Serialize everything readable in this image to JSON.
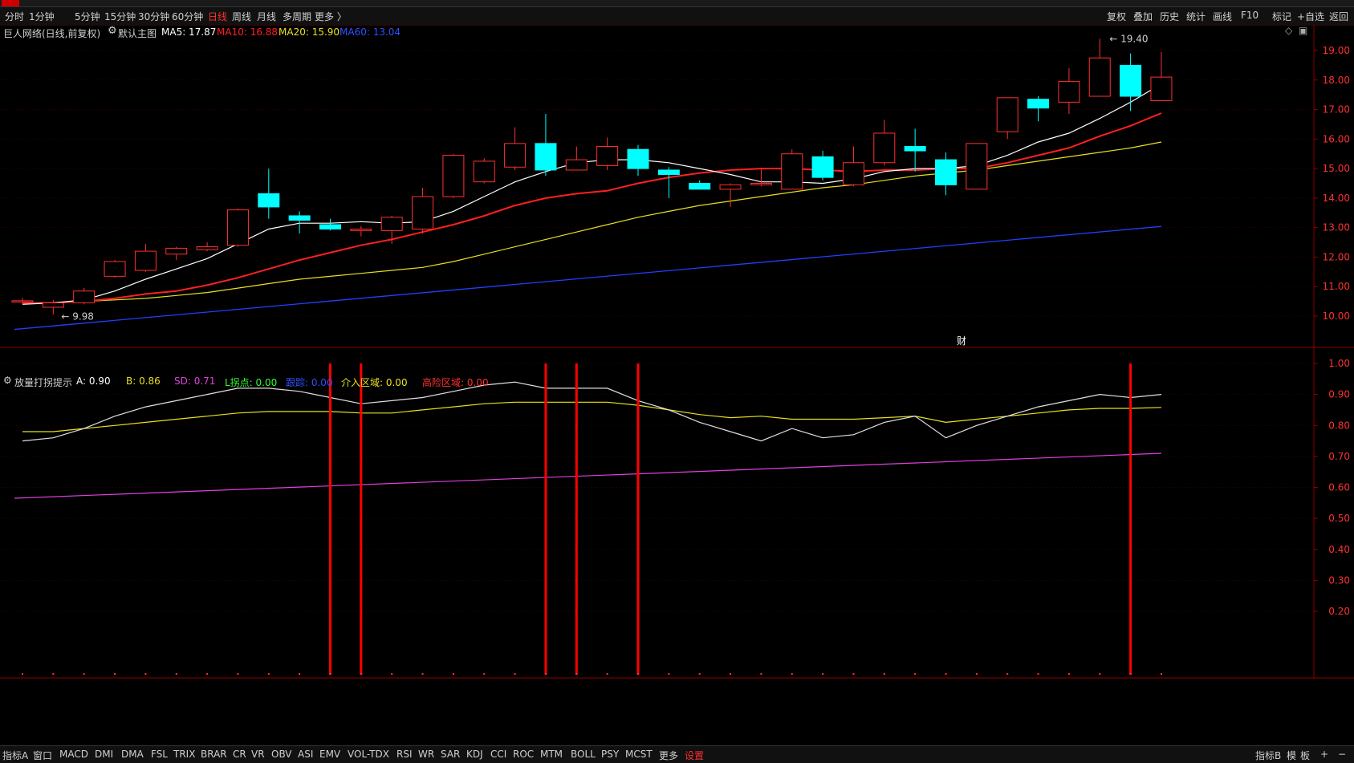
{
  "period_bar": {
    "items": [
      "分时",
      "1分钟",
      "5分钟",
      "15分钟",
      "30分钟",
      "60分钟",
      "日线",
      "周线",
      "月线",
      "多周期",
      "更多 〉"
    ],
    "active": "日线",
    "right_items": [
      "复权",
      "叠加",
      "历史",
      "统计",
      "画线",
      "F10",
      "标记",
      "+自选",
      "返回"
    ]
  },
  "main_info": {
    "stock": "巨人网络(日线,前复权)",
    "chart": "默认主图",
    "ma5": "MA5: 17.87",
    "ma10": "MA10: 16.88",
    "ma20": "MA20: 15.90",
    "ma60": "MA60: 13.04"
  },
  "colors": {
    "ma5": "#ffffff",
    "ma10": "#ff2020",
    "ma20": "#e8e020",
    "ma60": "#2040ff",
    "up": "#ff3030",
    "down": "#00ffff",
    "sd": "#e040e0",
    "signal": "#ff0000"
  },
  "price_axis": [
    "19.00",
    "18.00",
    "17.00",
    "16.00",
    "15.00",
    "14.00",
    "13.00",
    "12.00",
    "11.00",
    "10.00"
  ],
  "price_labels": {
    "high": "19.40",
    "low": "9.98",
    "caibao": "财"
  },
  "indicator_info": {
    "name": "放量打拐提示",
    "a": "A: 0.90",
    "b": "B: 0.86",
    "sd": "SD: 0.71",
    "l": "L拐点: 0.00",
    "gz": "跟踪: 0.00",
    "jr": "介入区域: 0.00",
    "gf": "高险区域: 0.00"
  },
  "indicator_axis": [
    "1.00",
    "0.90",
    "0.80",
    "0.70",
    "0.60",
    "0.50",
    "0.40",
    "0.30",
    "0.20"
  ],
  "date_axis": {
    "start": "2023/03/15/三",
    "m4": "4",
    "m5": "5",
    "period": "日线"
  },
  "bottom_bar": {
    "items": [
      "指标A",
      "窗口",
      "MACD",
      "DMI",
      "DMA",
      "FSL",
      "TRIX",
      "BRAR",
      "CR",
      "VR",
      "OBV",
      "ASI",
      "EMV",
      "VOL-TDX",
      "RSI",
      "WR",
      "SAR",
      "KDJ",
      "CCI",
      "ROC",
      "MTM",
      "BOLL",
      "PSY",
      "MCST",
      "更多",
      "设置"
    ],
    "right_items": [
      "指标B",
      "模",
      "板",
      "+",
      "−"
    ]
  },
  "chart_data": {
    "type": "candlestick",
    "candles": [
      {
        "o": 10.48,
        "h": 10.62,
        "l": 10.4,
        "c": 10.52
      },
      {
        "o": 10.3,
        "h": 10.55,
        "l": 10.05,
        "c": 10.45
      },
      {
        "o": 10.45,
        "h": 10.95,
        "l": 10.4,
        "c": 10.85
      },
      {
        "o": 11.35,
        "h": 11.9,
        "l": 11.3,
        "c": 11.85
      },
      {
        "o": 11.55,
        "h": 12.45,
        "l": 11.5,
        "c": 12.2
      },
      {
        "o": 12.1,
        "h": 12.35,
        "l": 11.9,
        "c": 12.3
      },
      {
        "o": 12.25,
        "h": 12.5,
        "l": 12.2,
        "c": 12.35
      },
      {
        "o": 12.4,
        "h": 13.65,
        "l": 12.35,
        "c": 13.6
      },
      {
        "o": 14.15,
        "h": 15.0,
        "l": 13.3,
        "c": 13.7
      },
      {
        "o": 13.4,
        "h": 13.55,
        "l": 12.8,
        "c": 13.25
      },
      {
        "o": 13.1,
        "h": 13.3,
        "l": 12.9,
        "c": 12.95
      },
      {
        "o": 12.9,
        "h": 13.05,
        "l": 12.7,
        "c": 12.95
      },
      {
        "o": 12.9,
        "h": 13.4,
        "l": 12.45,
        "c": 13.35
      },
      {
        "o": 12.95,
        "h": 14.35,
        "l": 12.8,
        "c": 14.05
      },
      {
        "o": 14.05,
        "h": 15.5,
        "l": 14.0,
        "c": 15.45
      },
      {
        "o": 14.55,
        "h": 15.35,
        "l": 14.5,
        "c": 15.25
      },
      {
        "o": 15.05,
        "h": 16.4,
        "l": 14.95,
        "c": 15.85
      },
      {
        "o": 15.85,
        "h": 16.85,
        "l": 14.75,
        "c": 14.95
      },
      {
        "o": 14.95,
        "h": 15.75,
        "l": 14.95,
        "c": 15.3
      },
      {
        "o": 15.1,
        "h": 16.05,
        "l": 14.95,
        "c": 15.75
      },
      {
        "o": 15.65,
        "h": 15.8,
        "l": 14.75,
        "c": 15.0
      },
      {
        "o": 14.95,
        "h": 15.05,
        "l": 14.0,
        "c": 14.8
      },
      {
        "o": 14.5,
        "h": 14.6,
        "l": 14.3,
        "c": 14.3
      },
      {
        "o": 14.3,
        "h": 14.5,
        "l": 13.7,
        "c": 14.45
      },
      {
        "o": 14.45,
        "h": 15.0,
        "l": 14.4,
        "c": 14.5
      },
      {
        "o": 14.3,
        "h": 15.65,
        "l": 14.3,
        "c": 15.5
      },
      {
        "o": 15.4,
        "h": 15.6,
        "l": 14.6,
        "c": 14.7
      },
      {
        "o": 14.45,
        "h": 15.75,
        "l": 14.4,
        "c": 15.2
      },
      {
        "o": 15.2,
        "h": 16.65,
        "l": 15.1,
        "c": 16.2
      },
      {
        "o": 15.75,
        "h": 16.35,
        "l": 14.9,
        "c": 15.6
      },
      {
        "o": 15.3,
        "h": 15.55,
        "l": 14.1,
        "c": 14.45
      },
      {
        "o": 14.3,
        "h": 15.85,
        "l": 14.3,
        "c": 15.85
      },
      {
        "o": 16.25,
        "h": 17.4,
        "l": 16.0,
        "c": 17.4
      },
      {
        "o": 17.35,
        "h": 17.45,
        "l": 16.6,
        "c": 17.05
      },
      {
        "o": 17.25,
        "h": 18.4,
        "l": 16.85,
        "c": 17.95
      },
      {
        "o": 17.45,
        "h": 19.4,
        "l": 17.45,
        "c": 18.75
      },
      {
        "o": 18.5,
        "h": 18.9,
        "l": 16.95,
        "c": 17.45
      },
      {
        "o": 17.3,
        "h": 18.95,
        "l": 17.3,
        "c": 18.1
      }
    ],
    "ma5": [
      10.4,
      10.45,
      10.55,
      10.85,
      11.25,
      11.6,
      11.95,
      12.45,
      12.95,
      13.15,
      13.15,
      13.2,
      13.15,
      13.2,
      13.55,
      14.05,
      14.55,
      14.9,
      15.2,
      15.3,
      15.3,
      15.2,
      15.0,
      14.8,
      14.55,
      14.55,
      14.5,
      14.65,
      14.9,
      15.0,
      15.0,
      15.1,
      15.45,
      15.9,
      16.2,
      16.7,
      17.25,
      17.87
    ],
    "ma10": [
      10.45,
      10.45,
      10.5,
      10.6,
      10.75,
      10.85,
      11.05,
      11.3,
      11.6,
      11.9,
      12.15,
      12.4,
      12.6,
      12.85,
      13.1,
      13.4,
      13.75,
      14.0,
      14.15,
      14.25,
      14.5,
      14.7,
      14.85,
      14.95,
      15.0,
      15.0,
      14.95,
      14.9,
      14.95,
      14.95,
      15.0,
      15.0,
      15.2,
      15.45,
      15.7,
      16.1,
      16.45,
      16.88
    ],
    "ma20": [
      10.45,
      10.45,
      10.5,
      10.55,
      10.6,
      10.7,
      10.8,
      10.95,
      11.1,
      11.25,
      11.35,
      11.45,
      11.55,
      11.65,
      11.85,
      12.1,
      12.35,
      12.6,
      12.85,
      13.1,
      13.35,
      13.55,
      13.75,
      13.9,
      14.05,
      14.2,
      14.35,
      14.45,
      14.6,
      14.75,
      14.85,
      14.95,
      15.1,
      15.25,
      15.4,
      15.55,
      15.7,
      15.9
    ],
    "ma60_range": [
      9.55,
      13.04
    ],
    "A": [
      0.75,
      0.76,
      0.79,
      0.83,
      0.86,
      0.88,
      0.9,
      0.92,
      0.92,
      0.91,
      0.89,
      0.87,
      0.88,
      0.89,
      0.91,
      0.93,
      0.94,
      0.92,
      0.92,
      0.92,
      0.88,
      0.85,
      0.81,
      0.78,
      0.75,
      0.79,
      0.76,
      0.77,
      0.81,
      0.83,
      0.76,
      0.8,
      0.83,
      0.86,
      0.88,
      0.9,
      0.89,
      0.9
    ],
    "B": [
      0.78,
      0.78,
      0.79,
      0.8,
      0.81,
      0.82,
      0.83,
      0.84,
      0.845,
      0.845,
      0.845,
      0.84,
      0.84,
      0.85,
      0.86,
      0.87,
      0.875,
      0.875,
      0.875,
      0.875,
      0.865,
      0.85,
      0.835,
      0.825,
      0.83,
      0.82,
      0.82,
      0.82,
      0.825,
      0.83,
      0.81,
      0.82,
      0.83,
      0.84,
      0.85,
      0.855,
      0.855,
      0.858
    ],
    "SD_range": [
      0.565,
      0.71
    ],
    "signals_at": [
      10,
      11,
      17,
      18,
      20,
      36
    ]
  }
}
